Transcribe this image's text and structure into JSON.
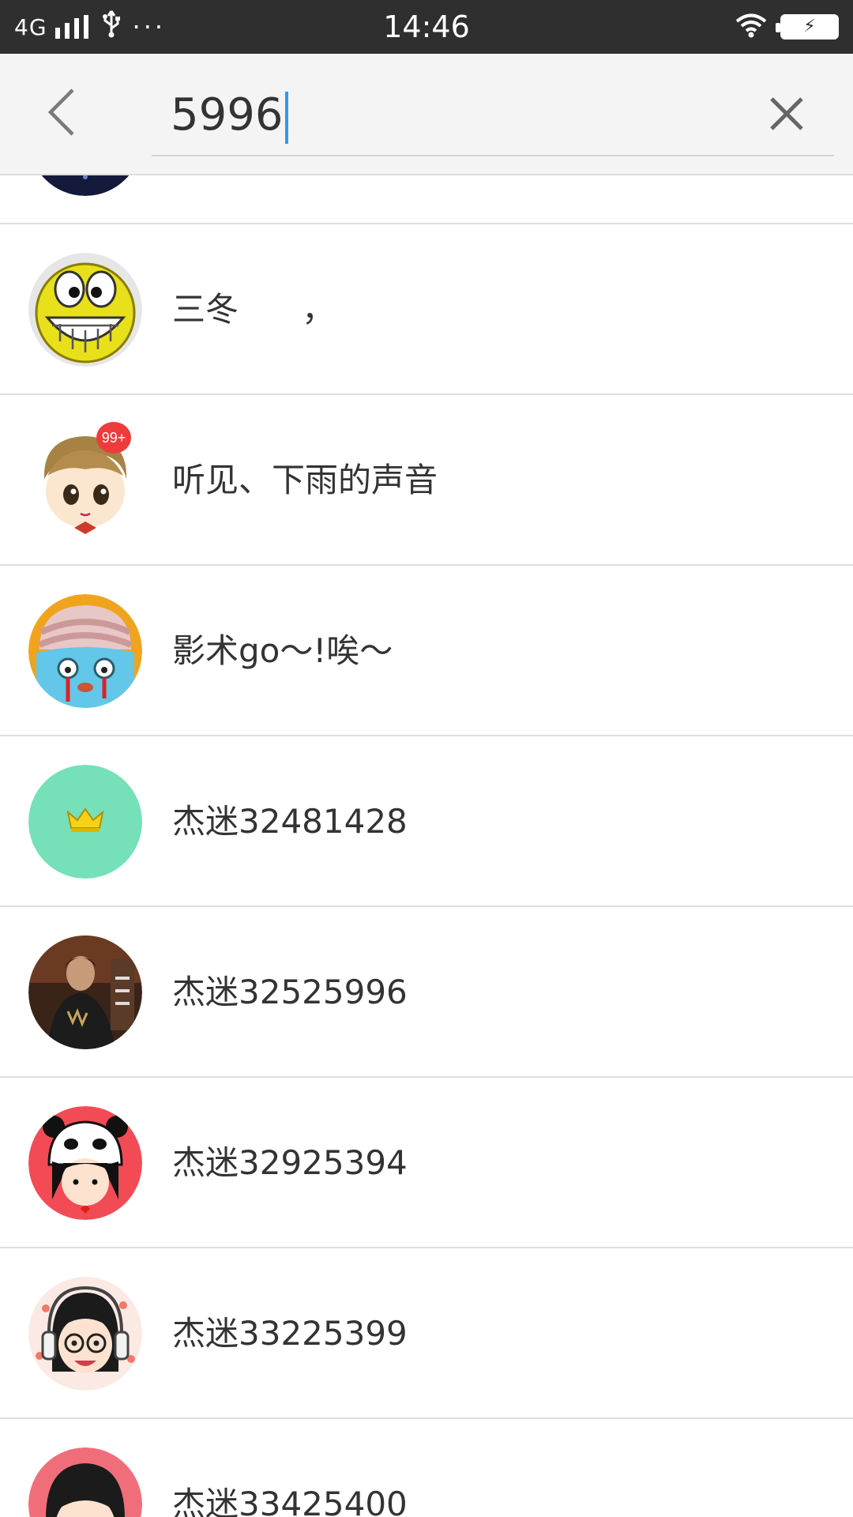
{
  "status_bar": {
    "network": "4G",
    "time": "14:46",
    "more": "···",
    "usb_icon": "usb-icon",
    "wifi_icon": "wifi-icon",
    "battery_icon": "battery-charging-icon"
  },
  "search": {
    "query": "5996",
    "back_icon": "back-chevron-icon",
    "clear_icon": "clear-x-icon",
    "caret_color": "#2b9af3"
  },
  "results": [
    {
      "label": "",
      "avatar": "dark-partial-avatar"
    },
    {
      "label": "三冬      ，",
      "avatar": "grinning-smiley-avatar"
    },
    {
      "label": "听见、下雨的声音",
      "avatar": "cartoon-boy-avatar",
      "badge": "99+"
    },
    {
      "label": "影术go～!唉～",
      "avatar": "crying-cartoon-avatar"
    },
    {
      "label": "杰迷32481428",
      "avatar": "crown-default-avatar"
    },
    {
      "label": "杰迷32525996",
      "avatar": "photo-person-avatar"
    },
    {
      "label": "杰迷32925394",
      "avatar": "panda-hat-girl-avatar"
    },
    {
      "label": "杰迷33225399",
      "avatar": "headphone-girl-avatar"
    },
    {
      "label": "杰迷33425400",
      "avatar": "cartoon-partial-avatar"
    }
  ]
}
